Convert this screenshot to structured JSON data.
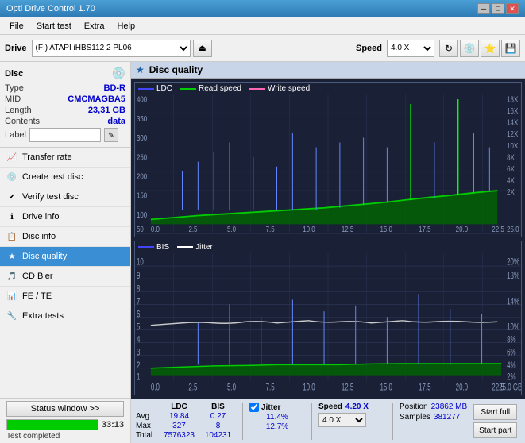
{
  "app": {
    "title": "Opti Drive Control 1.70",
    "titlebar_controls": [
      "minimize",
      "maximize",
      "close"
    ]
  },
  "menubar": {
    "items": [
      "File",
      "Start test",
      "Extra",
      "Help"
    ]
  },
  "topbar": {
    "drive_label": "Drive",
    "drive_value": "(F:)  ATAPI iHBS112  2 PL06",
    "speed_label": "Speed",
    "speed_value": "4.0 X"
  },
  "disc_panel": {
    "title": "Disc",
    "rows": [
      {
        "label": "Type",
        "value": "BD-R"
      },
      {
        "label": "MID",
        "value": "CMCMAGBA5"
      },
      {
        "label": "Length",
        "value": "23,31 GB"
      },
      {
        "label": "Contents",
        "value": "data"
      }
    ],
    "label_placeholder": ""
  },
  "nav_menu": {
    "items": [
      {
        "id": "transfer-rate",
        "label": "Transfer rate",
        "icon": "📈"
      },
      {
        "id": "create-test-disc",
        "label": "Create test disc",
        "icon": "💿"
      },
      {
        "id": "verify-test-disc",
        "label": "Verify test disc",
        "icon": "✔"
      },
      {
        "id": "drive-info",
        "label": "Drive info",
        "icon": "ℹ"
      },
      {
        "id": "disc-info",
        "label": "Disc info",
        "icon": "📋"
      },
      {
        "id": "disc-quality",
        "label": "Disc quality",
        "icon": "★",
        "active": true
      },
      {
        "id": "cd-bier",
        "label": "CD Bier",
        "icon": "🎵"
      },
      {
        "id": "fe-te",
        "label": "FE / TE",
        "icon": "📊"
      },
      {
        "id": "extra-tests",
        "label": "Extra tests",
        "icon": "🔧"
      }
    ]
  },
  "status": {
    "window_btn": "Status window >>",
    "progress": 100,
    "time": "33:13",
    "status_text": "Test completed"
  },
  "chart": {
    "title": "Disc quality",
    "top_legend": [
      "LDC",
      "Read speed",
      "Write speed"
    ],
    "bottom_legend": [
      "BIS",
      "Jitter"
    ],
    "x_max": 25.0,
    "top_y_max": 400,
    "top_y_right_max": 18,
    "bottom_y_max": 10,
    "bottom_y_right_max": 20
  },
  "stats": {
    "headers": [
      "LDC",
      "BIS",
      "",
      "Jitter",
      "Speed",
      ""
    ],
    "avg_label": "Avg",
    "avg_ldc": "19.84",
    "avg_bis": "0.27",
    "avg_jitter": "11.4%",
    "avg_speed": "4.20 X",
    "speed_select": "4.0 X",
    "max_label": "Max",
    "max_ldc": "327",
    "max_bis": "8",
    "max_jitter": "12.7%",
    "position_label": "Position",
    "position_val": "23862 MB",
    "total_label": "Total",
    "total_ldc": "7576323",
    "total_bis": "104231",
    "samples_label": "Samples",
    "samples_val": "381277",
    "start_full_label": "Start full",
    "start_part_label": "Start part",
    "jitter_checked": true,
    "jitter_label": "Jitter"
  }
}
